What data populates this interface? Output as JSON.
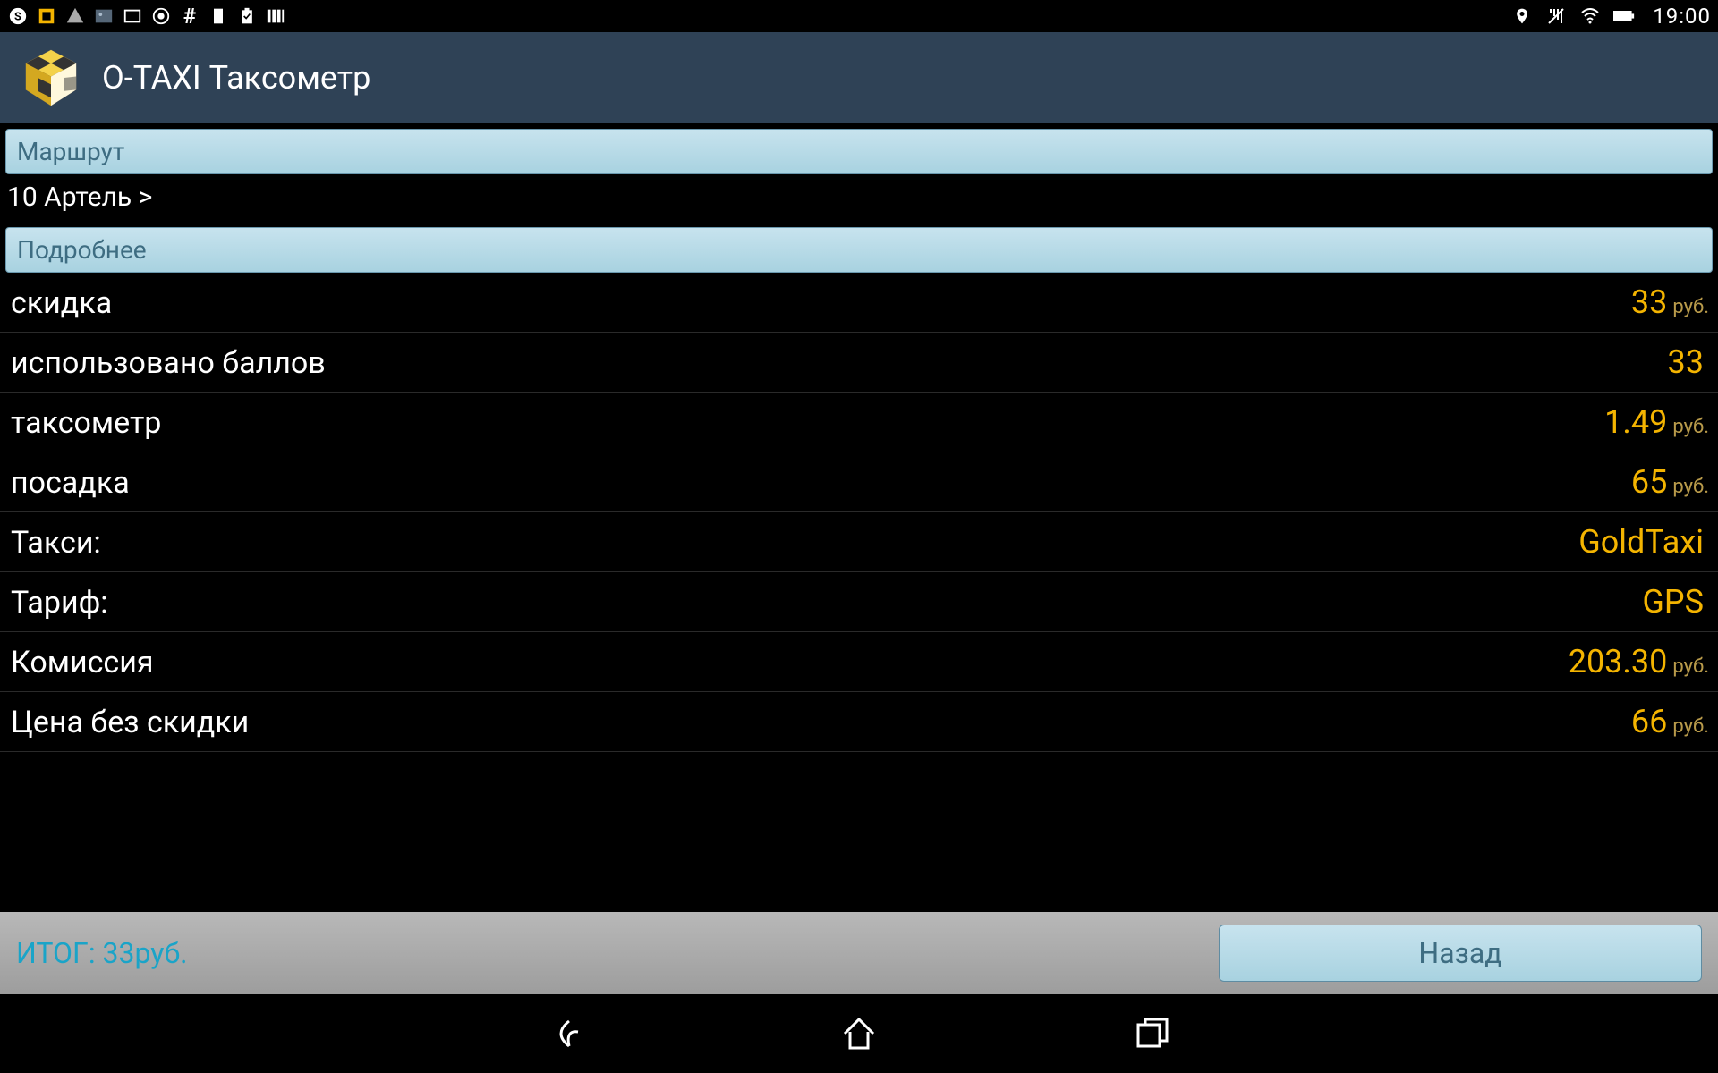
{
  "status": {
    "time": "19:00"
  },
  "app": {
    "title": "O-TAXI Таксометр"
  },
  "sections": {
    "route_header": "Маршрут",
    "route_value": "10 Артель  >",
    "details_header": "Подробнее"
  },
  "rows": [
    {
      "label": "скидка",
      "value": "33",
      "unit": "руб."
    },
    {
      "label": "использовано баллов",
      "value": "33",
      "unit": ""
    },
    {
      "label": "таксометр",
      "value": "1.49",
      "unit": "руб."
    },
    {
      "label": "посадка",
      "value": "65",
      "unit": "руб."
    },
    {
      "label": "Такси:",
      "value": "GoldTaxi",
      "unit": ""
    },
    {
      "label": "Тариф:",
      "value": "GPS",
      "unit": ""
    },
    {
      "label": "Комиссия",
      "value": "203.30",
      "unit": "руб."
    },
    {
      "label": "Цена без скидки",
      "value": "66",
      "unit": "руб."
    }
  ],
  "footer": {
    "total": "ИТОГ: 33руб.",
    "back": "Назад"
  }
}
